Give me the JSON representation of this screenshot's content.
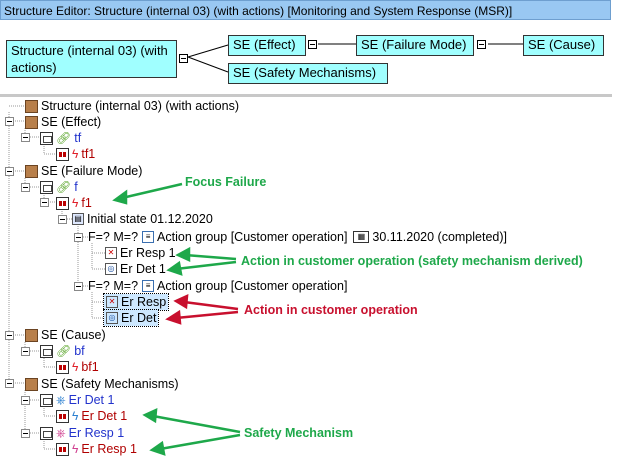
{
  "window": {
    "title": "Structure Editor: Structure (internal 03) (with actions) [Monitoring and System Response (MSR)]"
  },
  "diagram": {
    "root": "Structure (internal 03) (with actions)",
    "effect": "SE (Effect)",
    "failure_mode": "SE (Failure Mode)",
    "cause": "SE (Cause)",
    "safety": "SE (Safety Mechanisms)"
  },
  "tree": {
    "root": "Structure (internal 03) (with actions)",
    "se_effect": "SE (Effect)",
    "tf": "tf",
    "tf1": "tf1",
    "se_failure_mode": "SE (Failure Mode)",
    "f": "f",
    "f1": "f1",
    "initial_state": "Initial state 01.12.2020",
    "fm_prefix_1": "F=? M=?",
    "action_group_1": "Action group [Customer operation]",
    "completed": "30.11.2020 (completed)",
    "er_resp_1": "Er Resp 1",
    "er_det_1": "Er Det 1",
    "fm_prefix_2": "F=? M=?",
    "action_group_2": "Action group [Customer operation]",
    "er_resp": "Er Resp",
    "er_det": "Er Det",
    "se_cause": "SE (Cause)",
    "bf": "bf",
    "bf1": "bf1",
    "se_safety": "SE (Safety Mechanisms)",
    "sm_er_det_1": "Er Det 1",
    "sm_er_det_1_child": "Er Det 1",
    "sm_er_resp_1": "Er Resp 1",
    "sm_er_resp_1_child": "Er Resp 1"
  },
  "annotations": {
    "focus_failure": "Focus Failure",
    "action_derived": "Action in customer operation (safety mechanism derived)",
    "action": "Action in customer operation",
    "safety_mechanism": "Safety Mechanism"
  },
  "colors": {
    "green": "#1ea84a",
    "red": "#c8102e",
    "box": "#a0ffff",
    "title": "#99c8f2"
  }
}
